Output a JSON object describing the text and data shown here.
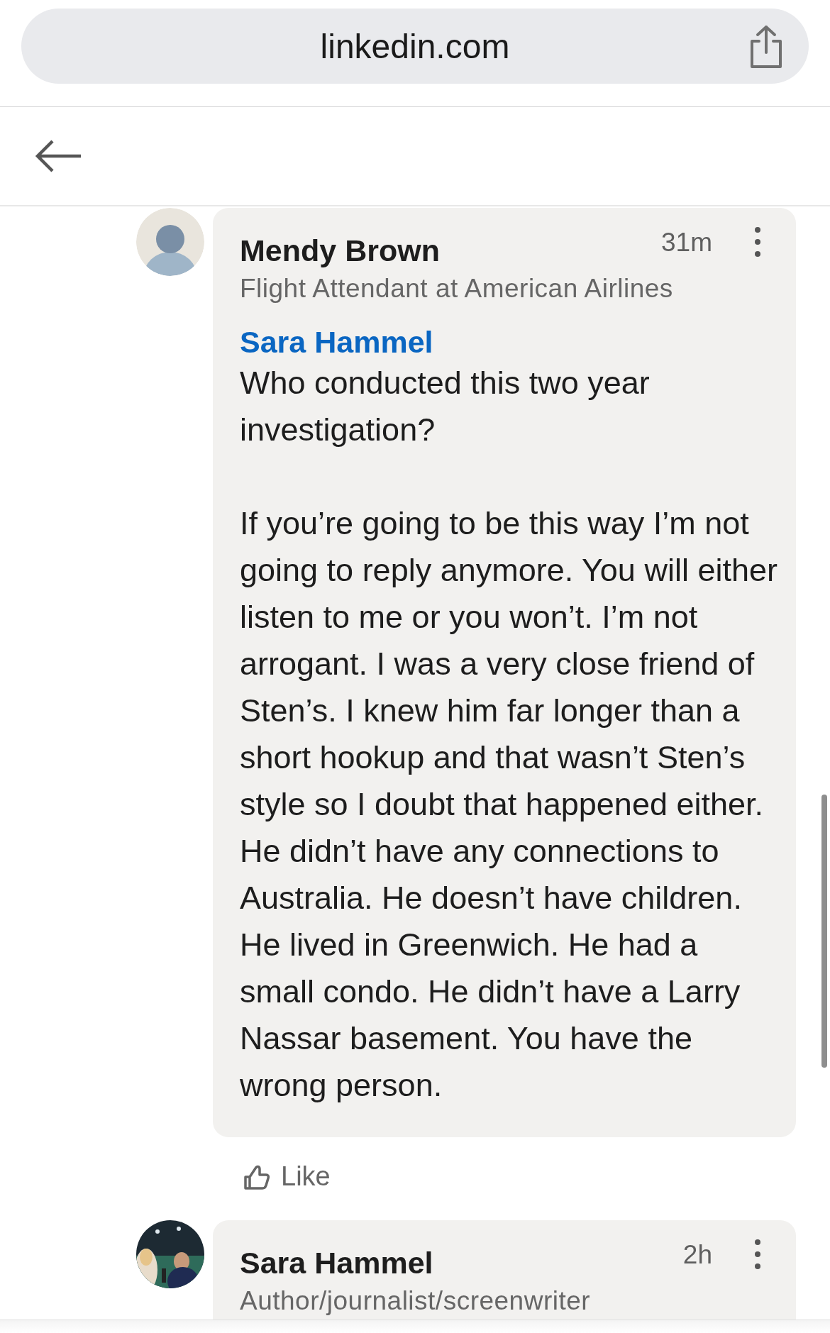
{
  "browser": {
    "url": "linkedin.com"
  },
  "comments": [
    {
      "avatar": {
        "kind": "silhouette"
      },
      "author": "Mendy Brown",
      "time": "31m",
      "headline": "Flight Attendant at American Airlines",
      "mention": "Sara Hammel",
      "paragraphs": [
        "Who conducted this two year investigation?",
        "If you’re going to be this way I’m not going to reply anymore. You will either listen to me or you won’t. I’m not arrogant. I was a very close friend of Sten’s. I knew him far longer than a short hookup and that wasn’t Sten’s style so I doubt that happened either. He didn’t have any connections to Australia. He doesn’t have children. He lived in Greenwich. He had a small condo. He didn’t have a Larry Nassar basement. You have the wrong person."
      ],
      "like": "Like"
    },
    {
      "author": "Sara Hammel",
      "time": "2h",
      "headline": "Author/journalist/screenwriter"
    }
  ]
}
